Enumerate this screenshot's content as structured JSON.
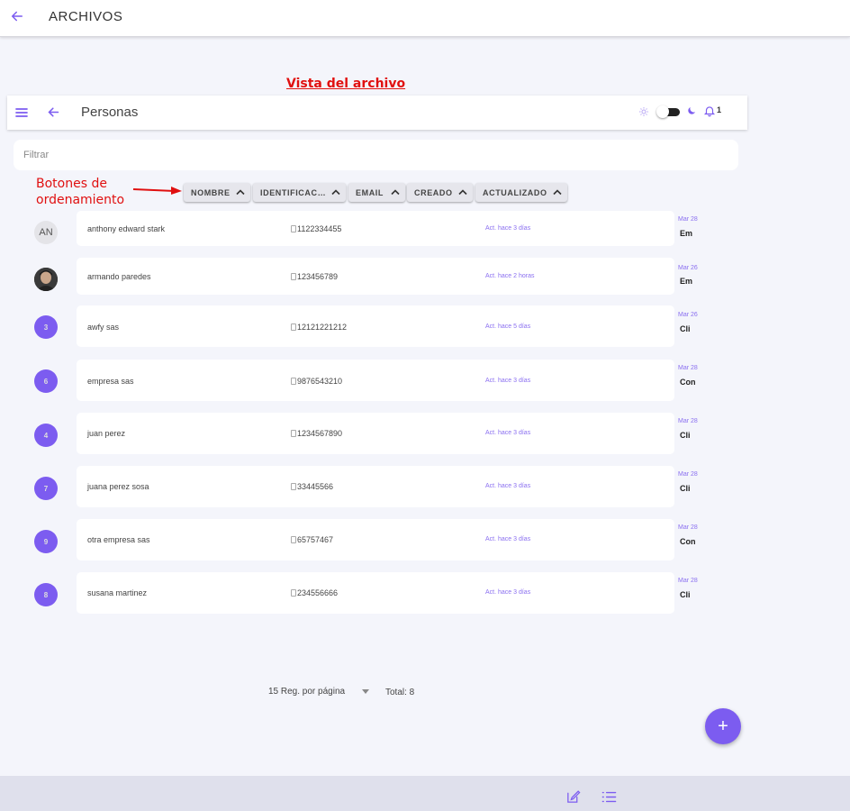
{
  "topbar": {
    "title": "ARCHIVOS"
  },
  "caption": "Vista del archivo",
  "appbar": {
    "title": "Personas",
    "notification_count": "1"
  },
  "filter": {
    "placeholder": "Filtrar",
    "value": ""
  },
  "annotation": {
    "line1": "Botones de",
    "line2": "ordenamiento"
  },
  "sort_buttons": [
    "NOMBRE",
    "IDENTIFICAC…",
    "EMAIL",
    "CREADO",
    "ACTUALIZADO"
  ],
  "rows": [
    {
      "avatar": "AN",
      "avatar_type": "initials",
      "name": "anthony edward stark",
      "id": "1122334455",
      "updated": "Act. hace 3 días",
      "date": "Mar 28",
      "tag": "Em"
    },
    {
      "avatar": "",
      "avatar_type": "photo",
      "name": "armando paredes",
      "id": "123456789",
      "updated": "Act. hace 2 horas",
      "date": "Mar 26",
      "tag": "Em"
    },
    {
      "avatar": "3",
      "avatar_type": "number",
      "name": "awfy sas",
      "id": "12121221212",
      "updated": "Act. hace 5 días",
      "date": "Mar 26",
      "tag": "Cli"
    },
    {
      "avatar": "6",
      "avatar_type": "number",
      "name": "empresa sas",
      "id": "9876543210",
      "updated": "Act. hace 3 días",
      "date": "Mar 28",
      "tag": "Con"
    },
    {
      "avatar": "4",
      "avatar_type": "number",
      "name": "juan perez",
      "id": "1234567890",
      "updated": "Act. hace 3 días",
      "date": "Mar 28",
      "tag": "Cli"
    },
    {
      "avatar": "7",
      "avatar_type": "number",
      "name": "juana perez sosa",
      "id": "33445566",
      "updated": "Act. hace 3 días",
      "date": "Mar 28",
      "tag": "Cli"
    },
    {
      "avatar": "9",
      "avatar_type": "number",
      "name": "otra empresa sas",
      "id": "65757467",
      "updated": "Act. hace 3 días",
      "date": "Mar 28",
      "tag": "Con"
    },
    {
      "avatar": "8",
      "avatar_type": "number",
      "name": "susana martinez",
      "id": "234556666",
      "updated": "Act. hace 3 días",
      "date": "Mar 28",
      "tag": "Cli"
    }
  ],
  "pager": {
    "per_page": "15 Reg. por página",
    "total": "Total: 8"
  },
  "fab": {
    "label": "+"
  },
  "icons": {
    "back": "arrow-left-icon",
    "menu": "hamburger-menu-icon",
    "sun": "sun-icon",
    "moon": "moon-icon",
    "bell": "bell-icon",
    "edit": "edit-icon",
    "list": "list-icon"
  },
  "colors": {
    "accent": "#7c5cf0",
    "annotation": "#e01010",
    "background": "#f4f5fb"
  }
}
